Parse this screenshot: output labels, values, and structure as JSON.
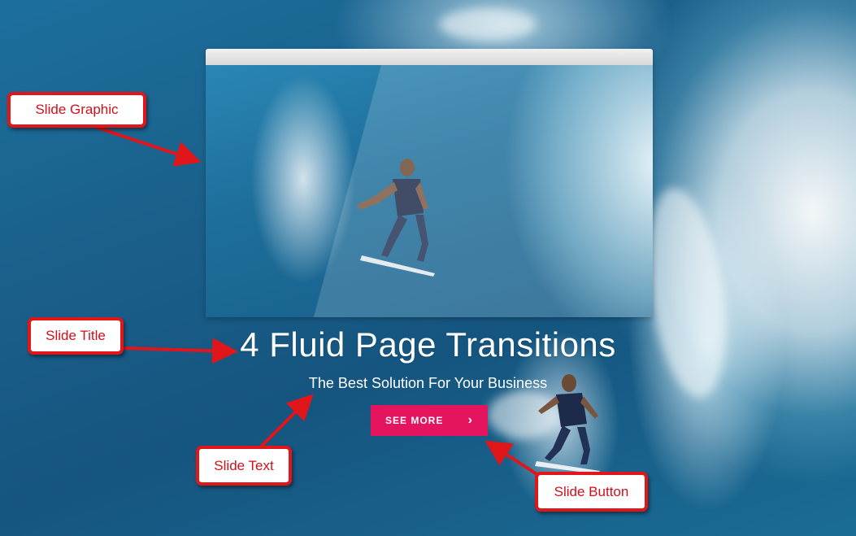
{
  "slide": {
    "title": "4 Fluid Page Transitions",
    "text": "The Best Solution For Your Business",
    "button": {
      "label": "SEE MORE",
      "icon": "chevron-right-icon",
      "glyph": "›",
      "color": "#e5145f"
    }
  },
  "annotations": {
    "graphic_label": "Slide Graphic",
    "title_label": "Slide Title",
    "text_label": "Slide Text",
    "button_label": "Slide Button",
    "color": "#e0161b"
  }
}
